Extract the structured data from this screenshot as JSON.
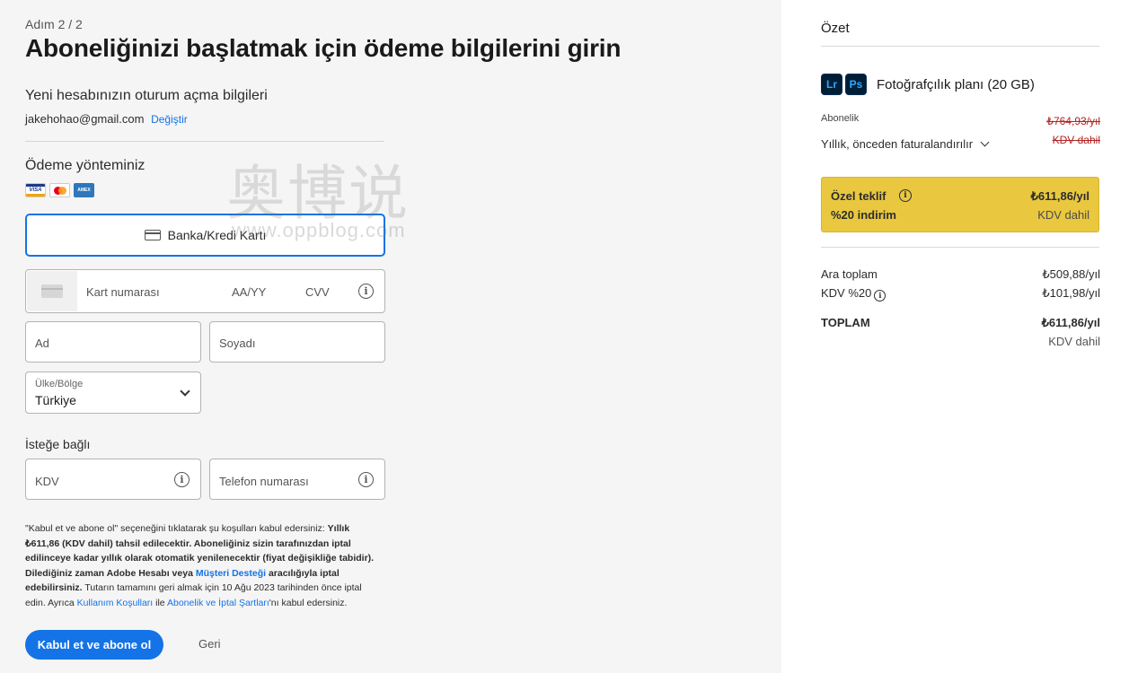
{
  "header": {
    "step": "Adım 2 / 2",
    "title": "Aboneliğinizi başlatmak için ödeme bilgilerini girin"
  },
  "account": {
    "heading": "Yeni hesabınızın oturum açma bilgileri",
    "email": "jakehohao@gmail.com",
    "change_link": "Değiştir"
  },
  "payment": {
    "heading": "Ödeme yönteminiz",
    "card_logos": [
      "VISA",
      "Mastercard",
      "AMEX"
    ],
    "visa_text": "VISA",
    "amex_text": "AMEX",
    "method_label": "Banka/Kredi Kartı",
    "card_number_placeholder": "Kart numarası",
    "expiry_placeholder": "AA/YY",
    "cvv_placeholder": "CVV",
    "first_name_placeholder": "Ad",
    "last_name_placeholder": "Soyadı",
    "country_label": "Ülke/Bölge",
    "country_value": "Türkiye"
  },
  "optional": {
    "heading": "İsteğe bağlı",
    "vat_placeholder": "KDV",
    "phone_placeholder": "Telefon numarası"
  },
  "legal": {
    "p1": "\"Kabul et ve abone ol\" seçeneğini tıklatarak şu koşulları kabul edersiniz: ",
    "b1": "Yıllık ₺611,86 (KDV dahil) tahsil edilecektir. Aboneliğiniz sizin tarafınızdan iptal edilinceye kadar yıllık olarak otomatik yenilenecektir (fiyat değişikliğe tabidir). Dilediğiniz zaman Adobe Hesabı veya ",
    "link1": "Müşteri Desteği",
    "b2": " aracılığıyla iptal edebilirsiniz.",
    "p2": " Tutarın tamamını geri almak için 10 Ağu 2023 tarihinden önce iptal edin. Ayrıca ",
    "link2": "Kullanım Koşulları",
    "p3": " ile ",
    "link3": "Abonelik ve İptal Şartları",
    "p4": "'nı kabul edersiniz."
  },
  "actions": {
    "submit_label": "Kabul et ve abone ol",
    "back_label": "Geri"
  },
  "watermark": {
    "text": "奥博说",
    "url": "www.oppblog.com"
  },
  "summary": {
    "title": "Özet",
    "app_icons": [
      "Lr",
      "Ps"
    ],
    "plan_name": "Fotoğrafçılık planı (20 GB)",
    "subscription_label": "Abonelik",
    "old_price": "₺764,93/yıl",
    "old_vat": "KDV dahil",
    "billing_option": "Yıllık, önceden faturalandırılır",
    "offer": {
      "label": "Özel teklif",
      "discount": "%20 indirim",
      "price": "₺611,86/yıl",
      "vat": "KDV dahil"
    },
    "subtotal_label": "Ara toplam",
    "subtotal_value": "₺509,88/yıl",
    "vat_label": "KDV %20",
    "vat_value": "₺101,98/yıl",
    "total_label": "TOPLAM",
    "total_value": "₺611,86/yıl",
    "total_vat": "KDV dahil"
  }
}
